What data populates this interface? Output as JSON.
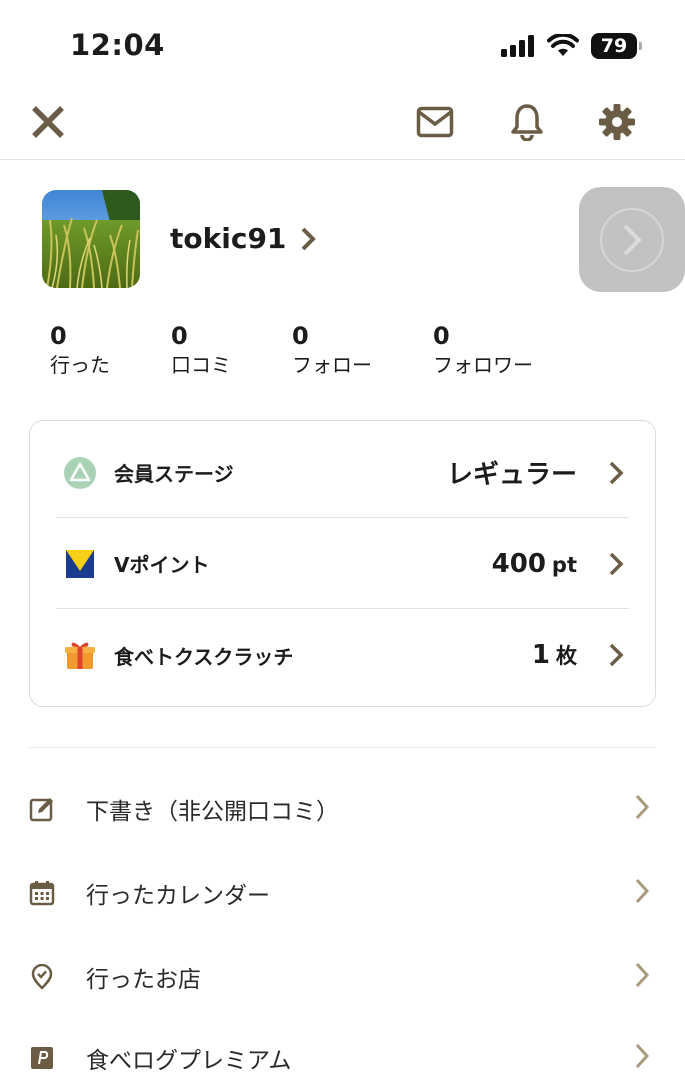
{
  "status_bar": {
    "time": "12:04",
    "battery": "79"
  },
  "nav": {
    "close": "close-icon",
    "mail": "mail-icon",
    "bell": "bell-icon",
    "settings": "gear-icon"
  },
  "profile": {
    "username": "tokic91"
  },
  "stats": [
    {
      "value": "0",
      "label": "行った"
    },
    {
      "value": "0",
      "label": "口コミ"
    },
    {
      "value": "0",
      "label": "フォロー"
    },
    {
      "value": "0",
      "label": "フォロワー"
    }
  ],
  "card": {
    "rows": [
      {
        "label": "会員ステージ",
        "value": "レギュラー",
        "unit": "",
        "icon": "member-stage-icon"
      },
      {
        "label": "Vポイント",
        "value": "400",
        "unit": "pt",
        "icon": "v-point-icon"
      },
      {
        "label": "食べトクスクラッチ",
        "value": "1",
        "unit": "枚",
        "icon": "gift-icon"
      }
    ]
  },
  "menu": [
    {
      "label": "下書き（非公開口コミ）",
      "icon": "edit-icon"
    },
    {
      "label": "行ったカレンダー",
      "icon": "calendar-icon"
    },
    {
      "label": "行ったお店",
      "icon": "location-check-icon"
    },
    {
      "label": "食べログプレミアム",
      "icon": "premium-icon"
    }
  ],
  "colors": {
    "accent": "#6b5d45",
    "chevron_light": "#a99a7c",
    "card_border": "#dcdcdc",
    "text": "#1c1c1c"
  }
}
